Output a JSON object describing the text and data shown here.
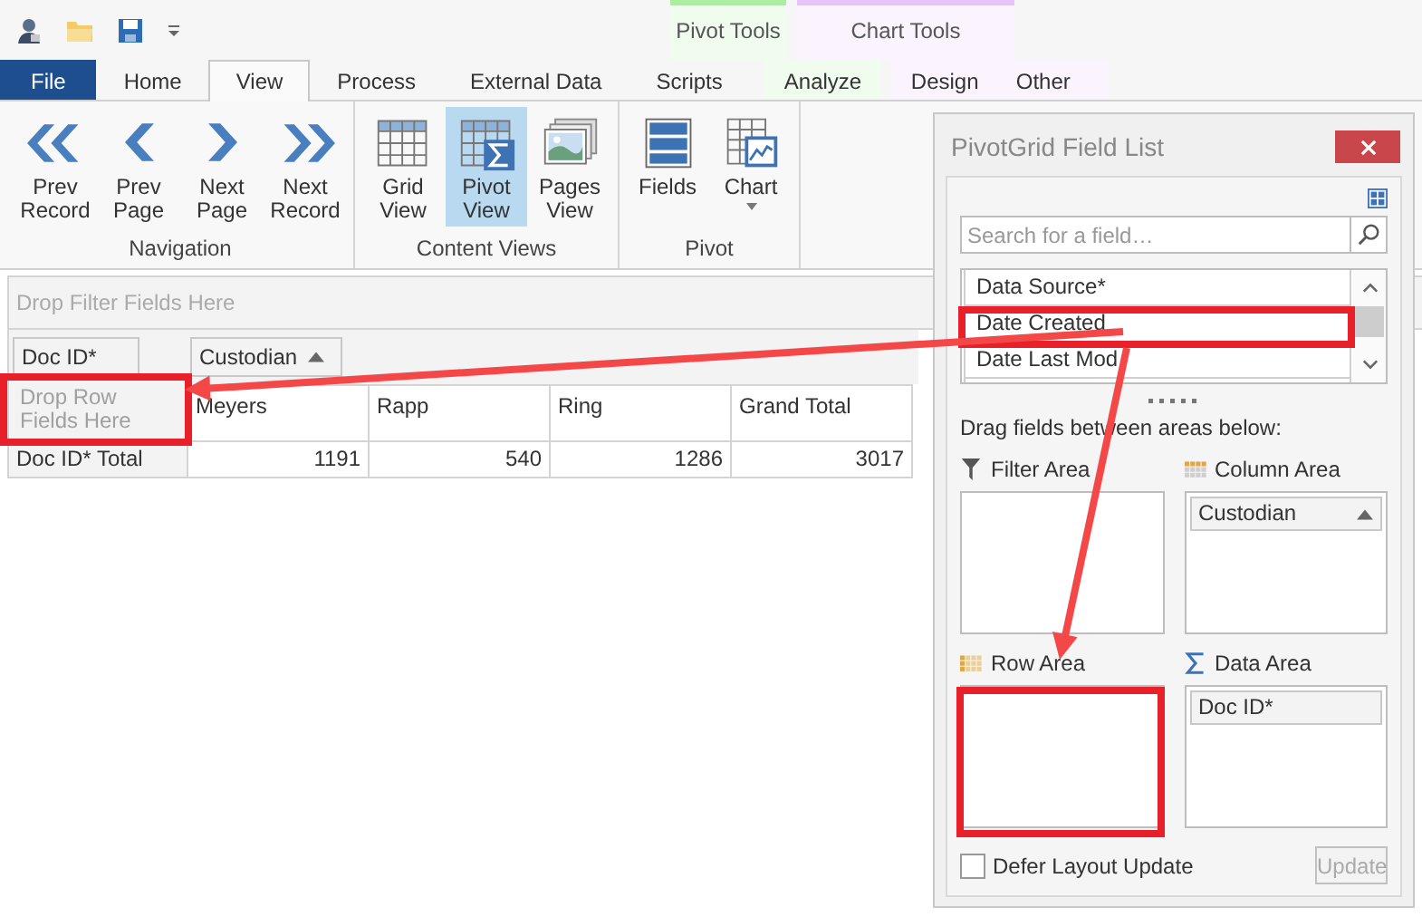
{
  "contextual_groups": [
    {
      "label": "Pivot Tools",
      "color": "#a8f0a0",
      "tabs": [
        {
          "label": "Analyze",
          "selected": false
        }
      ]
    },
    {
      "label": "Chart Tools",
      "color": "#e6c4f7",
      "tabs": [
        {
          "label": "Design",
          "selected": false
        },
        {
          "label": "Other",
          "selected": false
        }
      ]
    }
  ],
  "tabs": [
    {
      "label": "File",
      "kind": "file",
      "selected": false
    },
    {
      "label": "Home",
      "kind": "plain",
      "selected": false
    },
    {
      "label": "View",
      "kind": "plain",
      "selected": true
    },
    {
      "label": "Process",
      "kind": "plain",
      "selected": false
    },
    {
      "label": "External Data",
      "kind": "plain",
      "selected": false
    },
    {
      "label": "Scripts",
      "kind": "plain",
      "selected": false
    }
  ],
  "ribbon": {
    "groups": [
      {
        "label": "Navigation",
        "buttons": [
          {
            "label": "Prev Record",
            "selected": false
          },
          {
            "label": "Prev Page",
            "selected": false
          },
          {
            "label": "Next Page",
            "selected": false
          },
          {
            "label": "Next Record",
            "selected": false
          }
        ]
      },
      {
        "label": "Content Views",
        "buttons": [
          {
            "label": "Grid View",
            "selected": false
          },
          {
            "label": "Pivot View",
            "selected": true
          },
          {
            "label": "Pages View",
            "selected": false
          }
        ]
      },
      {
        "label": "Pivot",
        "buttons": [
          {
            "label": "Fields",
            "selected": false
          },
          {
            "label": "Chart",
            "selected": false,
            "dropdown": true
          }
        ]
      }
    ]
  },
  "pivot": {
    "filter_placeholder": "Drop Filter Fields Here",
    "data_fields": [
      {
        "label": "Doc ID*"
      }
    ],
    "column_fields": [
      {
        "label": "Custodian",
        "sort_ascending": true
      }
    ],
    "row_placeholder": "Drop Row Fields Here",
    "columns": [
      "Meyers",
      "Rapp",
      "Ring",
      "Grand Total"
    ],
    "rows": [
      {
        "label": "Doc ID* Total",
        "values": [
          "1191",
          "540",
          "1286",
          "3017"
        ]
      }
    ]
  },
  "field_list": {
    "title": "PivotGrid Field List",
    "search": {
      "placeholder": "Search for a field…"
    },
    "fields": [
      {
        "label": "Data Source*"
      },
      {
        "label": "Date Created"
      },
      {
        "label": "Date Last Mod"
      }
    ],
    "hint": "Drag fields between areas below:",
    "areas": [
      {
        "label": "Filter Area",
        "kind": "filter"
      },
      {
        "label": "Column Area",
        "kind": "column",
        "fields": [
          {
            "label": "Custodian",
            "sort_ascending": true
          }
        ]
      },
      {
        "label": "Row Area",
        "kind": "row"
      },
      {
        "label": "Data Area",
        "kind": "data",
        "fields": [
          {
            "label": "Doc ID*"
          }
        ]
      }
    ],
    "defer_layout_update": {
      "label": "Defer Layout Update",
      "checked": false
    },
    "update_button": {
      "label": "Update",
      "disabled": true
    }
  }
}
